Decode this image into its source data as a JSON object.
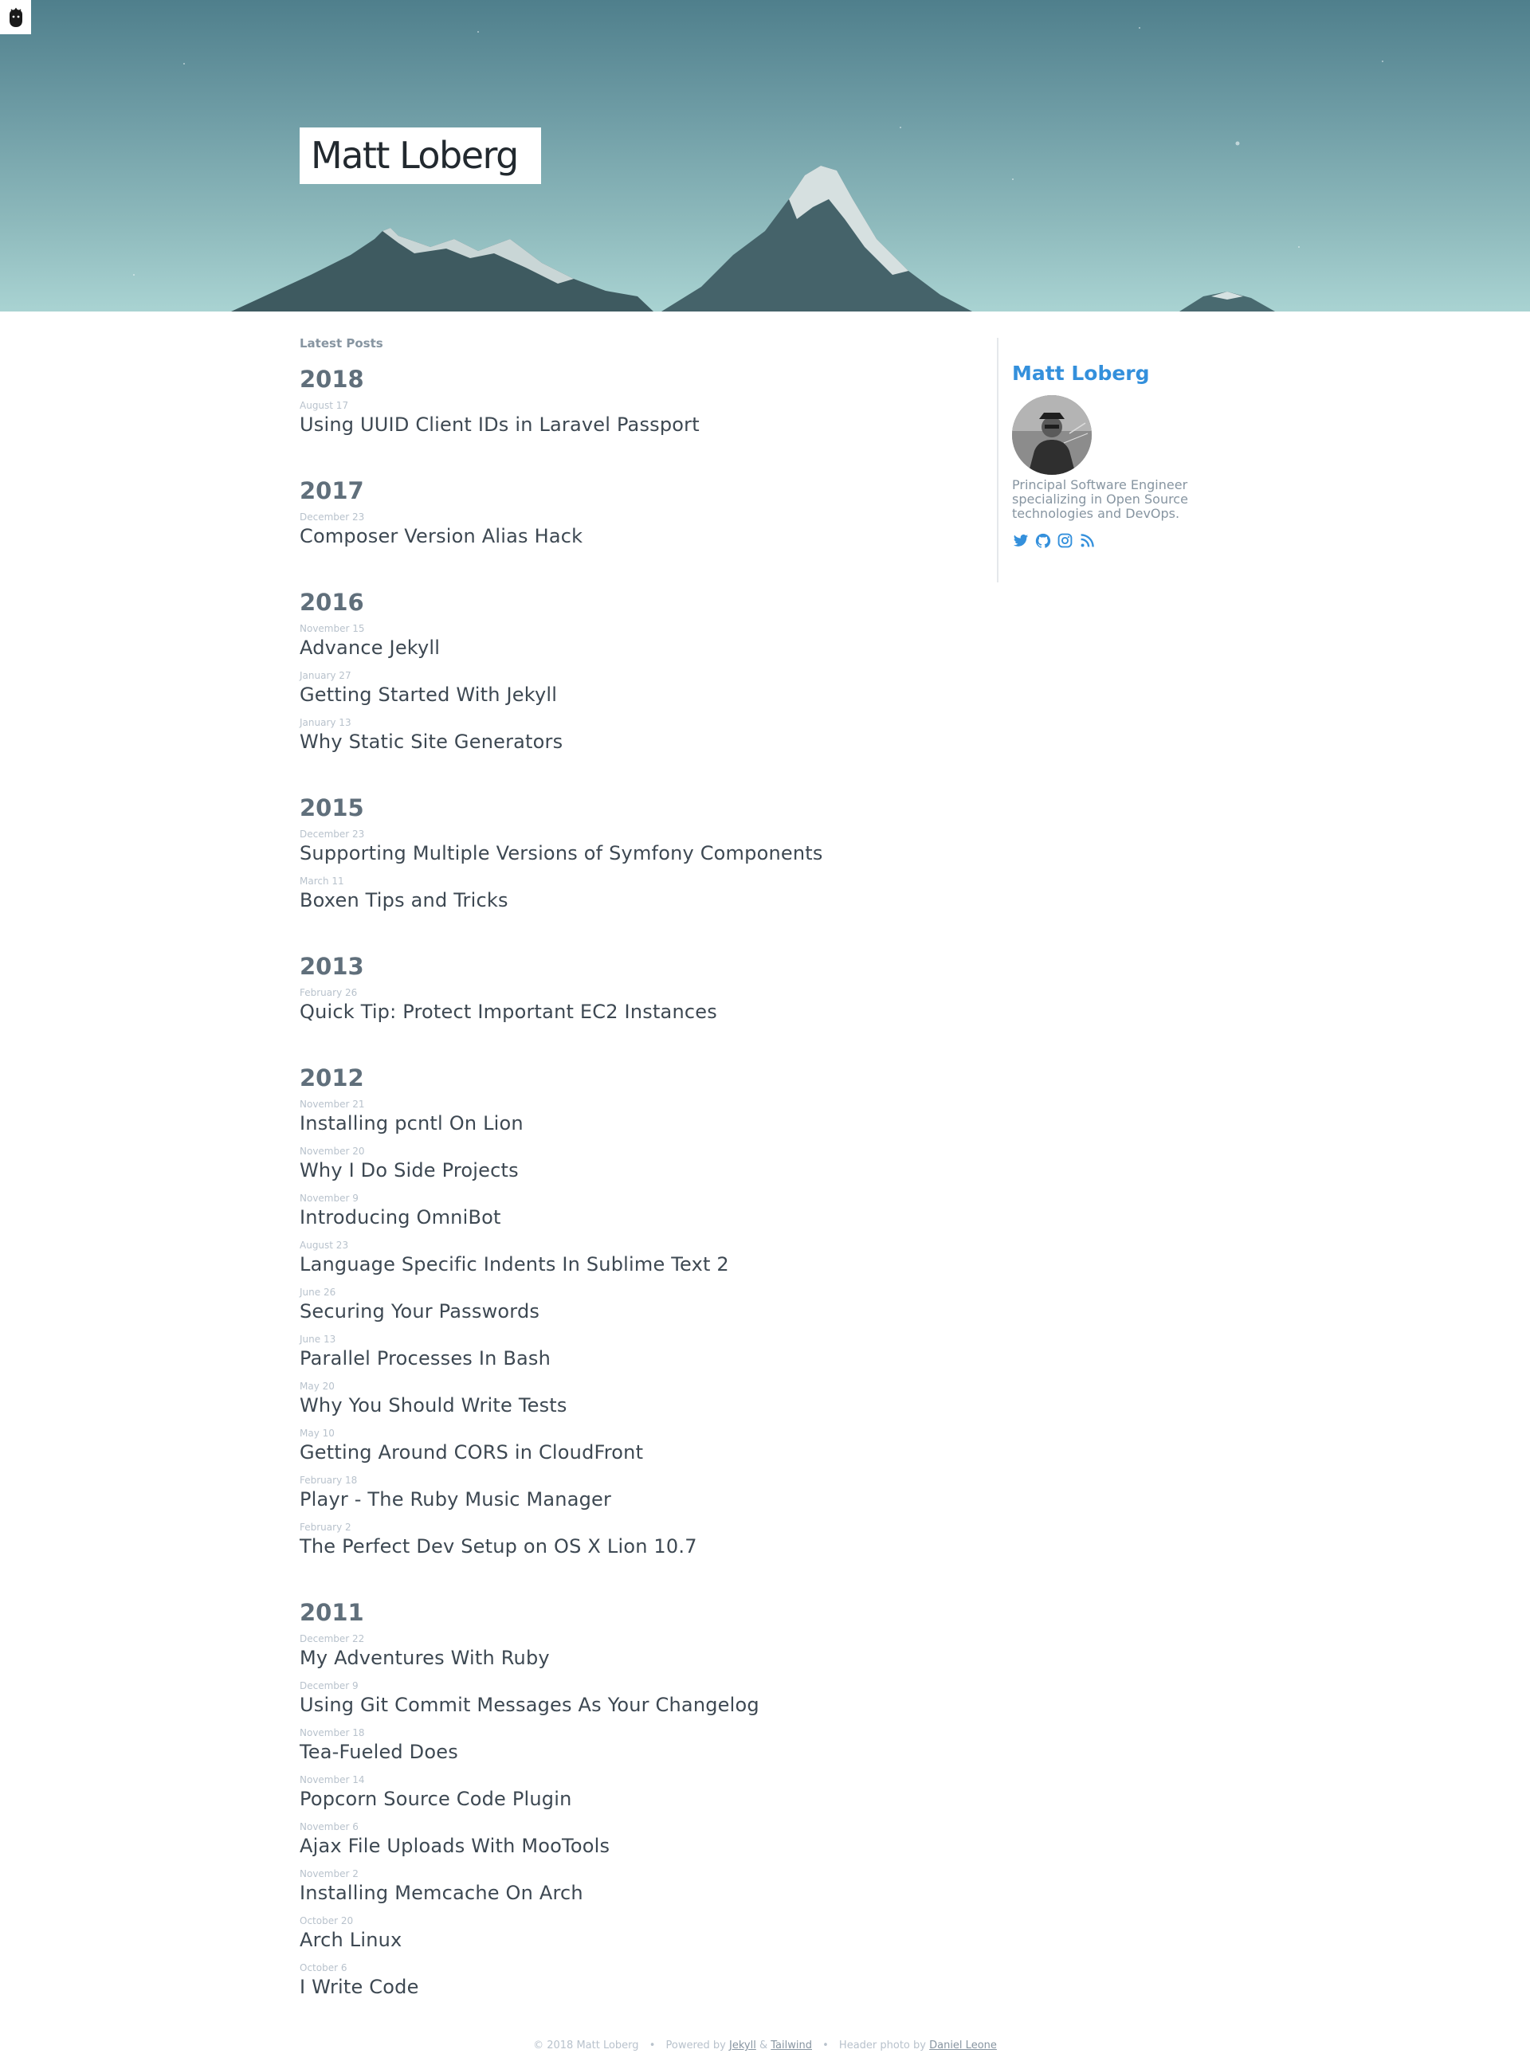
{
  "header": {
    "site_title": "Matt Loberg"
  },
  "main": {
    "section_label": "Latest Posts",
    "years": [
      {
        "year": "2018",
        "posts": [
          {
            "date": "August 17",
            "title": "Using UUID Client IDs in Laravel Passport"
          }
        ]
      },
      {
        "year": "2017",
        "posts": [
          {
            "date": "December 23",
            "title": "Composer Version Alias Hack"
          }
        ]
      },
      {
        "year": "2016",
        "posts": [
          {
            "date": "November 15",
            "title": "Advance Jekyll"
          },
          {
            "date": "January 27",
            "title": "Getting Started With Jekyll"
          },
          {
            "date": "January 13",
            "title": "Why Static Site Generators"
          }
        ]
      },
      {
        "year": "2015",
        "posts": [
          {
            "date": "December 23",
            "title": "Supporting Multiple Versions of Symfony Components"
          },
          {
            "date": "March 11",
            "title": "Boxen Tips and Tricks"
          }
        ]
      },
      {
        "year": "2013",
        "posts": [
          {
            "date": "February 26",
            "title": "Quick Tip: Protect Important EC2 Instances"
          }
        ]
      },
      {
        "year": "2012",
        "posts": [
          {
            "date": "November 21",
            "title": "Installing pcntl On Lion"
          },
          {
            "date": "November 20",
            "title": "Why I Do Side Projects"
          },
          {
            "date": "November 9",
            "title": "Introducing OmniBot"
          },
          {
            "date": "August 23",
            "title": "Language Specific Indents In Sublime Text 2"
          },
          {
            "date": "June 26",
            "title": "Securing Your Passwords"
          },
          {
            "date": "June 13",
            "title": "Parallel Processes In Bash"
          },
          {
            "date": "May 20",
            "title": "Why You Should Write Tests"
          },
          {
            "date": "May 10",
            "title": "Getting Around CORS in CloudFront"
          },
          {
            "date": "February 18",
            "title": "Playr - The Ruby Music Manager"
          },
          {
            "date": "February 2",
            "title": "The Perfect Dev Setup on OS X Lion 10.7"
          }
        ]
      },
      {
        "year": "2011",
        "posts": [
          {
            "date": "December 22",
            "title": "My Adventures With Ruby"
          },
          {
            "date": "December 9",
            "title": "Using Git Commit Messages As Your Changelog"
          },
          {
            "date": "November 18",
            "title": "Tea-Fueled Does"
          },
          {
            "date": "November 14",
            "title": "Popcorn Source Code Plugin"
          },
          {
            "date": "November 6",
            "title": "Ajax File Uploads With MooTools"
          },
          {
            "date": "November 2",
            "title": "Installing Memcache On Arch"
          },
          {
            "date": "October 20",
            "title": "Arch Linux"
          },
          {
            "date": "October 6",
            "title": "I Write Code"
          }
        ]
      }
    ]
  },
  "sidebar": {
    "name": "Matt Loberg",
    "bio": "Principal Software Engineer specializing in Open Source technologies and DevOps.",
    "social_icons": [
      "twitter-icon",
      "github-icon",
      "instagram-icon",
      "rss-icon"
    ]
  },
  "footer": {
    "copyright": "© 2018 Matt Loberg",
    "separator": "•",
    "powered_prefix": "Powered by",
    "jekyll": "Jekyll",
    "amp": "&",
    "tailwind": "Tailwind",
    "photo_prefix": "Header photo by",
    "photographer": "Daniel Leone"
  },
  "colors": {
    "accent": "#3490dc",
    "text": "#3d4852",
    "year": "#606f7b",
    "muted": "#b8c2cc"
  }
}
